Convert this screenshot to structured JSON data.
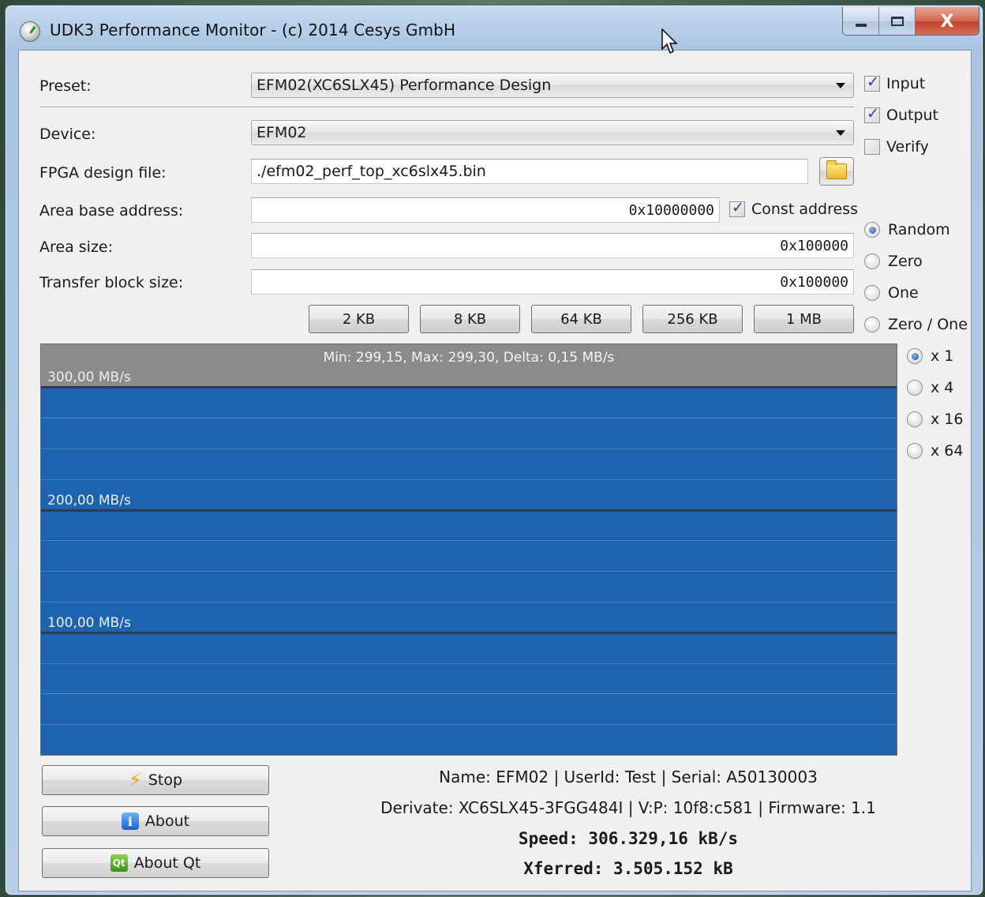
{
  "window": {
    "title": "UDK3 Performance Monitor - (c) 2014 Cesys GmbH",
    "close_glyph": "X",
    "icons": {
      "app": "gauge-icon",
      "minimize": "minimize-icon",
      "maximize": "maximize-icon",
      "close": "close-icon"
    }
  },
  "form": {
    "preset_label": "Preset:",
    "preset_value": "EFM02(XC6SLX45) Performance Design",
    "device_label": "Device:",
    "device_value": "EFM02",
    "fpga_label": "FPGA design file:",
    "fpga_value": "./efm02_perf_top_xc6slx45.bin",
    "area_base_label": "Area base address:",
    "area_base_value": "0x10000000",
    "const_address_label": "Const address",
    "const_address_checked": true,
    "area_size_label": "Area size:",
    "area_size_value": "0x100000",
    "transfer_label": "Transfer block size:",
    "transfer_value": "0x100000"
  },
  "size_buttons": [
    "2 KB",
    "8 KB",
    "64 KB",
    "256 KB",
    "1 MB"
  ],
  "options": {
    "input": {
      "label": "Input",
      "checked": true
    },
    "output": {
      "label": "Output",
      "checked": true
    },
    "verify": {
      "label": "Verify",
      "checked": false
    }
  },
  "patterns": [
    "Random",
    "Zero",
    "One",
    "Zero / One"
  ],
  "pattern_selected": "Random",
  "scales": [
    "x 1",
    "x 4",
    "x 16",
    "x 64"
  ],
  "scale_selected": "x 1",
  "chart_data": {
    "type": "area",
    "stats": "Min: 299,15, Max: 299,30, Delta: 0,15 MB/s",
    "y_tick_labels": [
      "300,00 MB/s",
      "200,00 MB/s",
      "100,00 MB/s"
    ],
    "y_ticks": [
      300,
      200,
      100
    ],
    "ylim": [
      0,
      335
    ],
    "grid_step": 25,
    "series_value": 299.3,
    "fill_color": "#1e63ad"
  },
  "buttons": {
    "stop": "Stop",
    "about": "About",
    "about_qt": "About Qt",
    "qt_glyph": "Qt"
  },
  "device_info": {
    "line1": "Name: EFM02 | UserId: Test | Serial: A50130003",
    "line2": "Derivate: XC6SLX45-3FGG484I | V:P: 10f8:c581 | Firmware: 1.1",
    "speed": "Speed: 306.329,16 kB/s",
    "xferred": "Xferred: 3.505.152 kB"
  }
}
